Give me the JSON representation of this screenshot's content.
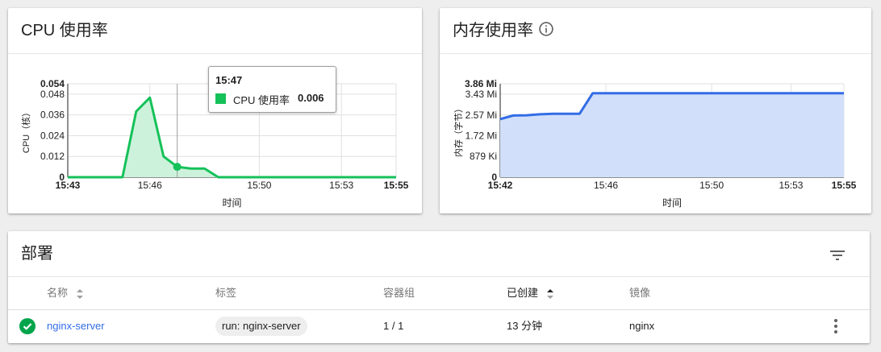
{
  "cpu_card": {
    "title": "CPU 使用率",
    "tooltip": {
      "time": "15:47",
      "series": "CPU 使用率",
      "value": "0.006"
    }
  },
  "memory_card": {
    "title": "内存使用率",
    "info_icon": "info-icon"
  },
  "chart_data": [
    {
      "type": "area",
      "title": "CPU 使用率",
      "xlabel": "时间",
      "ylabel": "CPU（核）",
      "x_ticks": [
        "15:43",
        "15:46",
        "15:50",
        "15:53",
        "15:55"
      ],
      "y_ticks": [
        "0",
        "0.012",
        "0.024",
        "0.036",
        "0.048",
        "0.054"
      ],
      "xlim": [
        "15:43",
        "15:55"
      ],
      "ylim": [
        0,
        0.054
      ],
      "grid": true,
      "color": "#15c159",
      "series": [
        {
          "x": [
            "15:43",
            "15:44",
            "15:45",
            "15:45:30",
            "15:46",
            "15:46:30",
            "15:47",
            "15:47:30",
            "15:48",
            "15:48:30",
            "15:49",
            "15:50",
            "15:51",
            "15:52",
            "15:53",
            "15:54",
            "15:55"
          ],
          "values": [
            0,
            0,
            0,
            0.038,
            0.046,
            0.012,
            0.006,
            0.005,
            0.005,
            0,
            0,
            0,
            0,
            0,
            0,
            0,
            0
          ]
        }
      ]
    },
    {
      "type": "area",
      "title": "内存使用率",
      "xlabel": "时间",
      "ylabel": "内存（字节）",
      "x_ticks": [
        "15:42",
        "15:46",
        "15:50",
        "15:53",
        "15:55"
      ],
      "y_ticks": [
        "0",
        "879 Ki",
        "1.72 Mi",
        "2.57 Mi",
        "3.43 Mi",
        "3.86 Mi"
      ],
      "xlim": [
        "15:42",
        "15:55"
      ],
      "ylim": [
        0,
        3.86
      ],
      "y_unit": "Mi",
      "grid": true,
      "color": "#326de6",
      "series": [
        {
          "x": [
            "15:42",
            "15:42:30",
            "15:43",
            "15:43:30",
            "15:44",
            "15:44:30",
            "15:45",
            "15:45:30",
            "15:46",
            "15:50",
            "15:53",
            "15:55"
          ],
          "values": [
            2.4,
            2.55,
            2.56,
            2.6,
            2.62,
            2.62,
            2.62,
            3.47,
            3.47,
            3.47,
            3.47,
            3.47
          ]
        }
      ]
    }
  ],
  "deployments": {
    "title": "部署",
    "filter_icon": "filter-icon",
    "columns": [
      "名称",
      "标签",
      "容器组",
      "已创建",
      "镜像"
    ],
    "rows": [
      {
        "status": "success",
        "name": "nginx-server",
        "label": "run: nginx-server",
        "pods": "1 / 1",
        "created": "13 分钟",
        "image": "nginx"
      }
    ]
  }
}
